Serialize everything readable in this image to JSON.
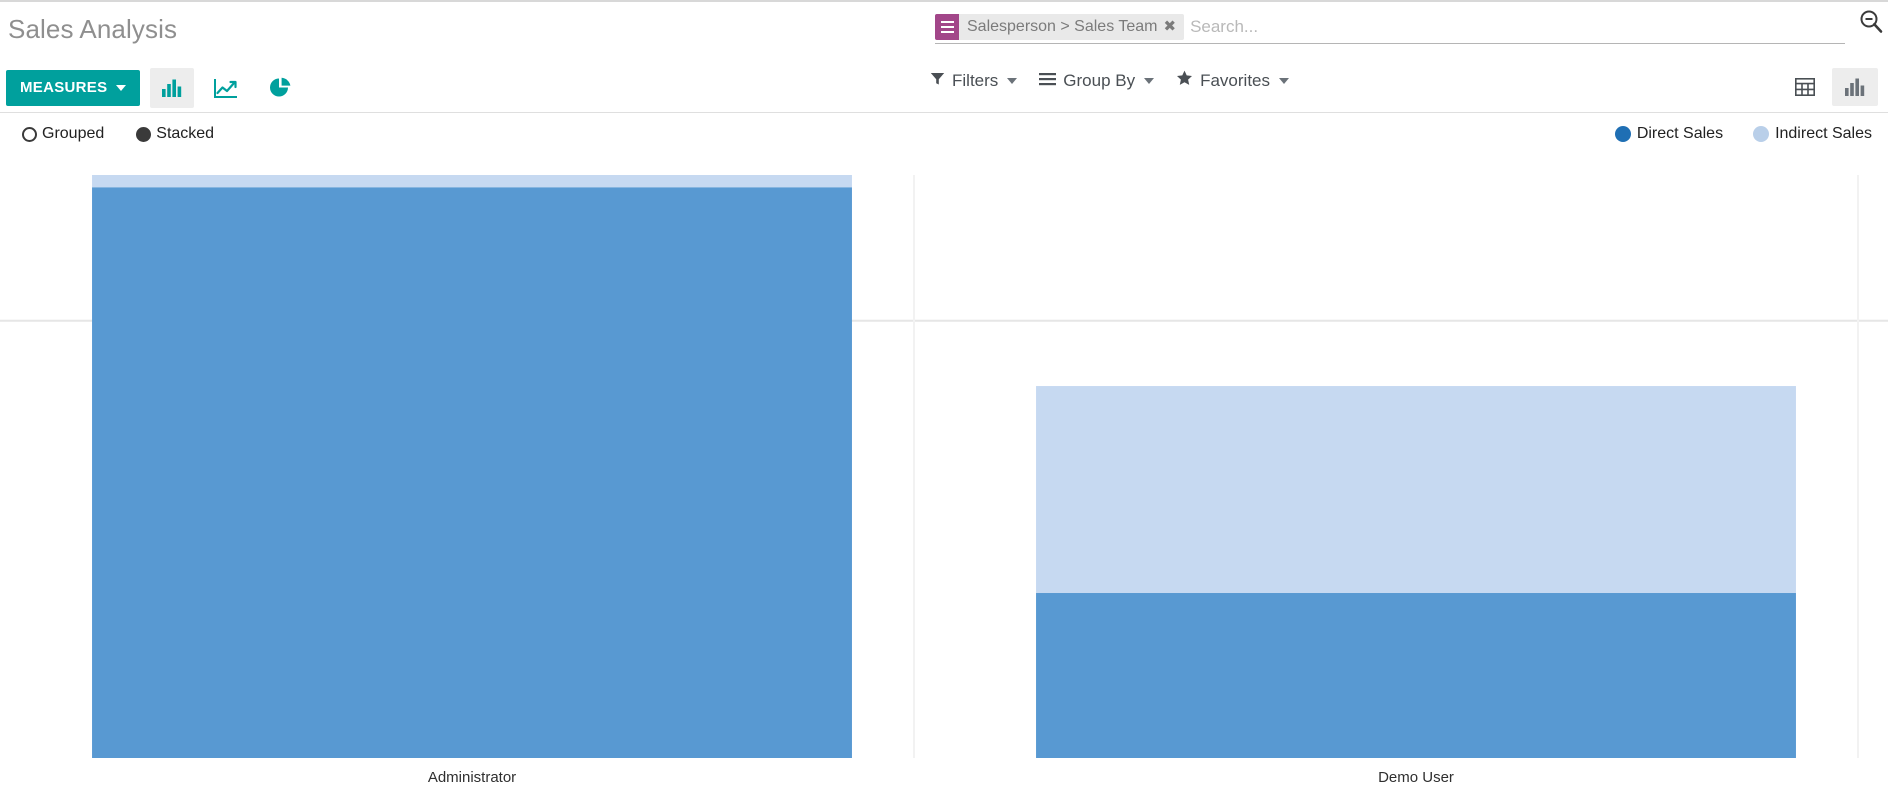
{
  "header": {
    "title": "Sales Analysis",
    "measures_label": "MEASURES",
    "chart_type_icons": [
      {
        "name": "bar-chart-icon",
        "active": true
      },
      {
        "name": "line-chart-icon",
        "active": false
      },
      {
        "name": "pie-chart-icon",
        "active": false
      }
    ]
  },
  "search": {
    "facet": {
      "icon": "group-by-icon",
      "label": "Salesperson > Sales Team",
      "remove": "✖"
    },
    "placeholder": "Search...",
    "value": "",
    "search_icon": "search-minus-icon"
  },
  "filters_bar": {
    "filters_label": "Filters",
    "filters_icon": "filter-icon",
    "group_by_label": "Group By",
    "group_by_icon": "bars-icon",
    "favorites_label": "Favorites",
    "favorites_icon": "star-icon"
  },
  "view_switcher": [
    {
      "name": "pivot-view-icon",
      "label": "Pivot",
      "active": false
    },
    {
      "name": "graph-view-icon",
      "label": "Graph",
      "active": true
    }
  ],
  "graph_controls": {
    "modes": [
      {
        "label": "Grouped",
        "selected": false
      },
      {
        "label": "Stacked",
        "selected": true
      }
    ]
  },
  "colors": {
    "accent_teal": "#00a09d",
    "facet_purple": "#a24689",
    "direct_sales": "#5899d2",
    "indirect_sales": "#c6d9f1",
    "gridline": "#e6e6e6",
    "title_grey": "#8f8f8f"
  },
  "chart_data": {
    "type": "bar",
    "title": "Sales Analysis",
    "stacked": true,
    "xlabel": "",
    "ylabel": "",
    "grid": true,
    "legend_position": "top-right",
    "categories": [
      "Administrator",
      "Demo User"
    ],
    "series": [
      {
        "name": "Direct Sales",
        "color": "#5899d2",
        "values": [
          97.9,
          28.3
        ]
      },
      {
        "name": "Indirect Sales",
        "color": "#c6d9f1",
        "values": [
          2.1,
          35.5
        ]
      }
    ],
    "totals": [
      100,
      63.8
    ],
    "ylim": [
      0,
      100
    ],
    "gridlines": [
      75
    ],
    "axis_tick_labels": [],
    "notes": "Stacked bar chart: Administrator total reaches the top of the plot area with a thin Indirect Sales cap; Demo User total is about 64% of Administrator's."
  }
}
